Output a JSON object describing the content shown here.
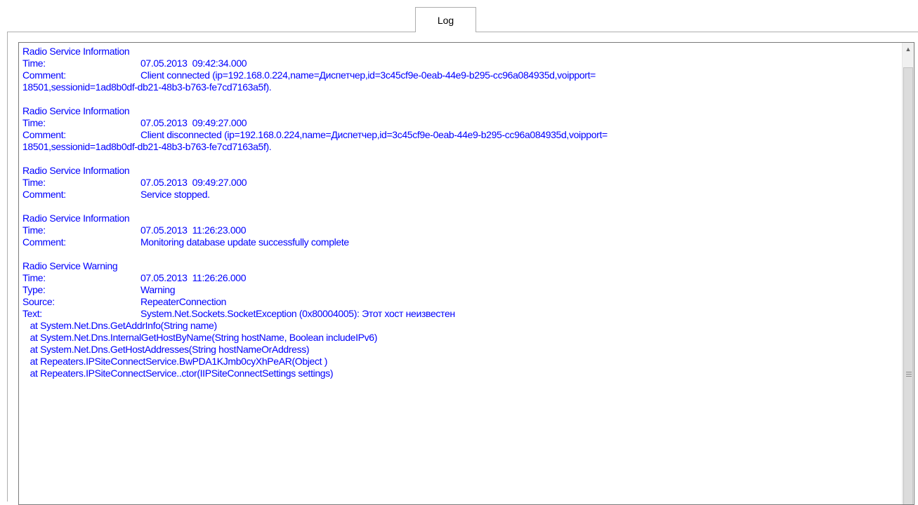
{
  "tab": {
    "label": "Log"
  },
  "log": {
    "entries": [
      {
        "header": "Radio Service Information",
        "rows": [
          {
            "key": "Time:",
            "value": "07.05.2013  09:42:34.000"
          },
          {
            "key": "Comment:",
            "value": "Client connected (ip=192.168.0.224,name=Диспетчер,id=3c45cf9e-0eab-44e9-b295-cc96a084935d,voipport="
          }
        ],
        "wrap": "18501,sessionid=1ad8b0df-db21-48b3-b763-fe7cd7163a5f)."
      },
      {
        "header": "Radio Service Information",
        "rows": [
          {
            "key": "Time:",
            "value": "07.05.2013  09:49:27.000"
          },
          {
            "key": "Comment:",
            "value": "Client disconnected (ip=192.168.0.224,name=Диспетчер,id=3c45cf9e-0eab-44e9-b295-cc96a084935d,voipport="
          }
        ],
        "wrap": "18501,sessionid=1ad8b0df-db21-48b3-b763-fe7cd7163a5f)."
      },
      {
        "header": "Radio Service Information",
        "rows": [
          {
            "key": "Time:",
            "value": "07.05.2013  09:49:27.000"
          },
          {
            "key": "Comment:",
            "value": "Service stopped."
          }
        ]
      },
      {
        "header": "Radio Service Information",
        "rows": [
          {
            "key": "Time:",
            "value": "07.05.2013  11:26:23.000"
          },
          {
            "key": "Comment:",
            "value": "Monitoring database update successfully complete"
          }
        ]
      },
      {
        "header": "Radio Service Warning",
        "rows": [
          {
            "key": "Time:",
            "value": "07.05.2013  11:26:26.000"
          },
          {
            "key": "Type:",
            "value": "Warning"
          },
          {
            "key": "Source:",
            "value": "RepeaterConnection"
          },
          {
            "key": "Text:",
            "value": "System.Net.Sockets.SocketException (0x80004005): Этот хост неизвестен"
          }
        ],
        "trace": [
          "   at System.Net.Dns.GetAddrInfo(String name)",
          "   at System.Net.Dns.InternalGetHostByName(String hostName, Boolean includeIPv6)",
          "   at System.Net.Dns.GetHostAddresses(String hostNameOrAddress)",
          "   at Repeaters.IPSiteConnectService.BwPDA1KJmb0cyXhPeAR(Object )",
          "   at Repeaters.IPSiteConnectService..ctor(IIPSiteConnectSettings settings)"
        ]
      }
    ]
  },
  "colors": {
    "log_text": "#0000ff",
    "border": "#7a7a7a",
    "scrollbar_track": "#f0f0f0"
  },
  "icons": {
    "scroll_up": "triangle-up-icon",
    "thumb_grip": "grip-lines-icon"
  }
}
